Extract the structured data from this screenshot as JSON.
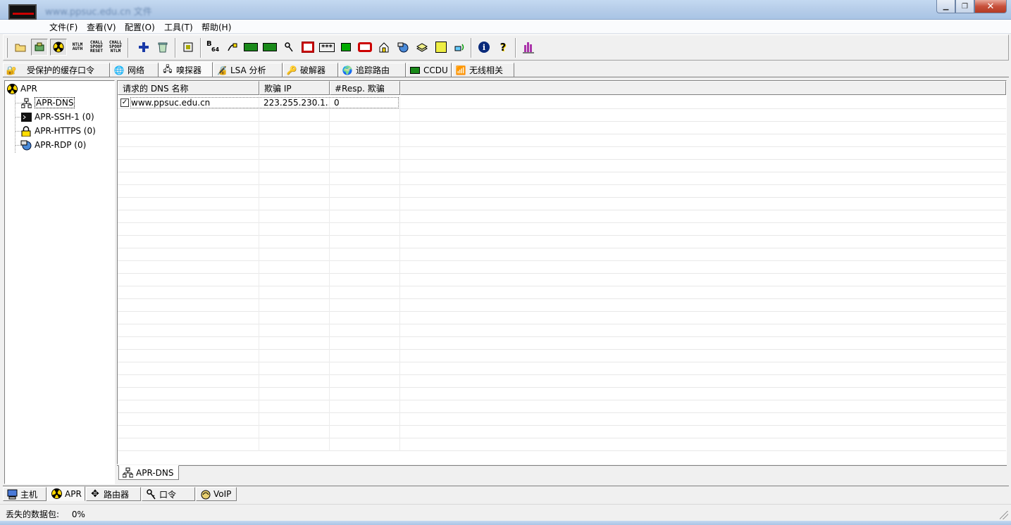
{
  "window": {
    "title": "www.ppsuc.edu.cn 文件"
  },
  "menu": [
    "文件(F)",
    "查看(V)",
    "配置(O)",
    "工具(T)",
    "帮助(H)"
  ],
  "toolbar": {
    "ntlm_auth": [
      "NTLM",
      "AUTH"
    ],
    "chall_spoof_reset": [
      "CHALL",
      "SPOOF",
      "RESET"
    ],
    "chall_spoof_ntlm": [
      "CHALL",
      "SPOOF",
      "NTLM"
    ],
    "b64_top": "B",
    "b64_bot": "64",
    "stars": "***"
  },
  "top_tabs": [
    "受保护的缓存口令",
    "网络",
    "嗅探器",
    "LSA 分析",
    "破解器",
    "追踪路由",
    "CCDU",
    "无线相关"
  ],
  "tree": {
    "root": "APR",
    "children": [
      "APR-DNS",
      "APR-SSH-1 (0)",
      "APR-HTTPS (0)",
      "APR-RDP (0)"
    ]
  },
  "list": {
    "columns": [
      "请求的 DNS 名称",
      "欺骗 IP",
      "#Resp. 欺骗"
    ],
    "rows": [
      {
        "checked": true,
        "name": "www.ppsuc.edu.cn",
        "ip": "223.255.230.1...",
        "resp": "0"
      }
    ]
  },
  "sub_tab": "APR-DNS",
  "bottom_tabs": [
    "主机",
    "APR",
    "路由器",
    "口令",
    "VoIP"
  ],
  "status": {
    "lost_packets_label": "丢失的数据包:",
    "lost_packets_value": "0%"
  }
}
